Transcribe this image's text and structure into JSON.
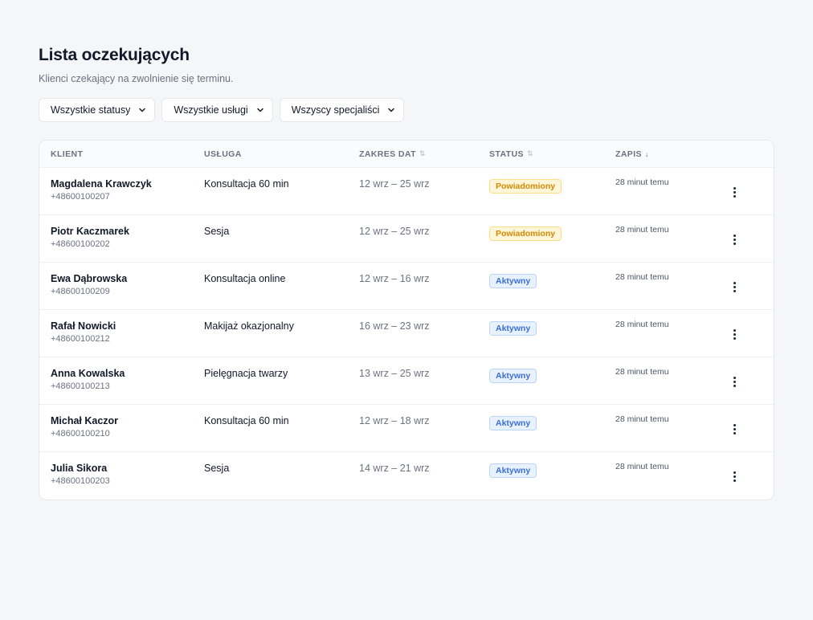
{
  "header": {
    "title": "Lista oczekujących",
    "subtitle": "Klienci czekający na zwolnienie się terminu."
  },
  "filters": [
    {
      "label": "Wszystkie statusy"
    },
    {
      "label": "Wszystkie usługi"
    },
    {
      "label": "Wszyscy specjaliści"
    }
  ],
  "table": {
    "columns": {
      "client": "KLIENT",
      "service": "USŁUGA",
      "range": "ZAKRES DAT",
      "status": "STATUS",
      "record": "ZAPIS"
    },
    "rows": [
      {
        "name": "Magdalena Krawczyk",
        "phone": "+48600100207",
        "service": "Konsultacja 60 min",
        "range": "12 wrz – 25 wrz",
        "status": "Powiadomiony",
        "status_kind": "notified",
        "record": "28 minut temu"
      },
      {
        "name": "Piotr Kaczmarek",
        "phone": "+48600100202",
        "service": "Sesja",
        "range": "12 wrz – 25 wrz",
        "status": "Powiadomiony",
        "status_kind": "notified",
        "record": "28 minut temu"
      },
      {
        "name": "Ewa Dąbrowska",
        "phone": "+48600100209",
        "service": "Konsultacja online",
        "range": "12 wrz – 16 wrz",
        "status": "Aktywny",
        "status_kind": "active",
        "record": "28 minut temu"
      },
      {
        "name": "Rafał Nowicki",
        "phone": "+48600100212",
        "service": "Makijaż okazjonalny",
        "range": "16 wrz – 23 wrz",
        "status": "Aktywny",
        "status_kind": "active",
        "record": "28 minut temu"
      },
      {
        "name": "Anna Kowalska",
        "phone": "+48600100213",
        "service": "Pielęgnacja twarzy",
        "range": "13 wrz – 25 wrz",
        "status": "Aktywny",
        "status_kind": "active",
        "record": "28 minut temu"
      },
      {
        "name": "Michał Kaczor",
        "phone": "+48600100210",
        "service": "Konsultacja 60 min",
        "range": "12 wrz – 18 wrz",
        "status": "Aktywny",
        "status_kind": "active",
        "record": "28 minut temu"
      },
      {
        "name": "Julia Sikora",
        "phone": "+48600100203",
        "service": "Sesja",
        "range": "14 wrz – 21 wrz",
        "status": "Aktywny",
        "status_kind": "active",
        "record": "28 minut temu"
      }
    ]
  },
  "icons": {
    "filter_chevron": "chevron-down-icon",
    "sort_neutral": "sort-icon",
    "sort_desc": "arrow-down-icon",
    "row_menu": "kebab-menu-icon"
  },
  "colors": {
    "notified_bg": "#fef6d6",
    "notified_text": "#d48806",
    "active_bg": "#e8f1fe",
    "active_text": "#3b6fd8"
  }
}
